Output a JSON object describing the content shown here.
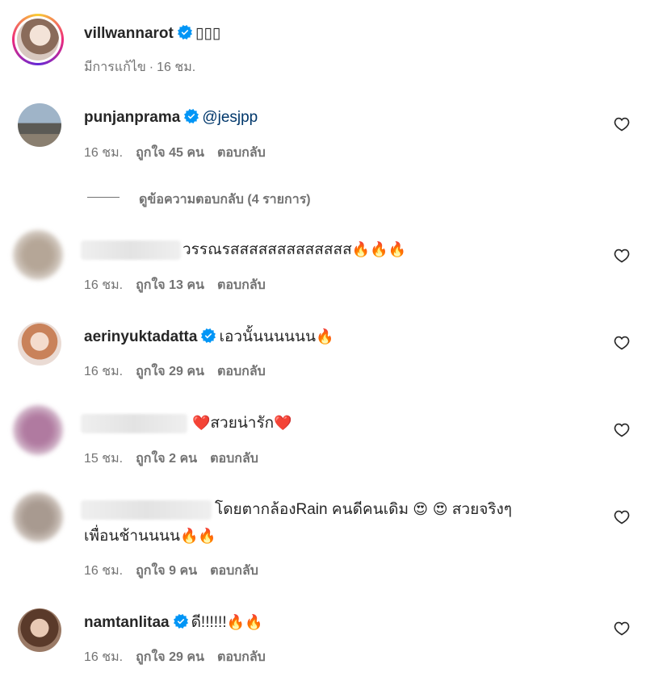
{
  "post": {
    "username": "villwannarot",
    "caption": "▯▯▯",
    "edited_label": "มีการแก้ไข",
    "time": "16 ชม."
  },
  "comments": [
    {
      "username": "punjanprama",
      "verified": true,
      "mention": "@jesjpp",
      "text": "",
      "time": "16 ชม.",
      "likes": "ถูกใจ 45 คน",
      "reply": "ตอบกลับ",
      "view_replies": "ดูข้อความตอบกลับ (4 รายการ)"
    },
    {
      "username": "",
      "text": "วรรณรสสสสสสสสสสสสส",
      "emoji": "🔥🔥🔥",
      "time": "16 ชม.",
      "likes": "ถูกใจ 13 คน",
      "reply": "ตอบกลับ"
    },
    {
      "username": "aerinyuktadatta",
      "verified": true,
      "text": "เอวนั้นนนนนน",
      "emoji": "🔥",
      "time": "16 ชม.",
      "likes": "ถูกใจ 29 คน",
      "reply": "ตอบกลับ"
    },
    {
      "username": "",
      "emoji_before": "❤️",
      "text": "สวยน่ารัก",
      "emoji": "❤️",
      "time": "15 ชม.",
      "likes": "ถูกใจ 2 คน",
      "reply": "ตอบกลับ"
    },
    {
      "username": "",
      "text": "โดยตากล้องRain คนดีคนเดิม",
      "emoji_mid": "😍 😍",
      "text2": "สวยจริงๆ",
      "line2": "เพื่อนช้านนนน",
      "emoji": "🔥🔥",
      "time": "16 ชม.",
      "likes": "ถูกใจ 9 คน",
      "reply": "ตอบกลับ"
    },
    {
      "username": "namtanlitaa",
      "verified": true,
      "text": "ดี!!!!!!",
      "emoji": "🔥🔥",
      "time": "16 ชม.",
      "likes": "ถูกใจ 29 คน",
      "reply": "ตอบกลับ"
    }
  ],
  "colors": {
    "verified_blue": "#0095f6",
    "secondary_text": "#737373",
    "mention_blue": "#00376b"
  },
  "icons": [
    "verified-badge-icon",
    "heart-outline-icon"
  ]
}
